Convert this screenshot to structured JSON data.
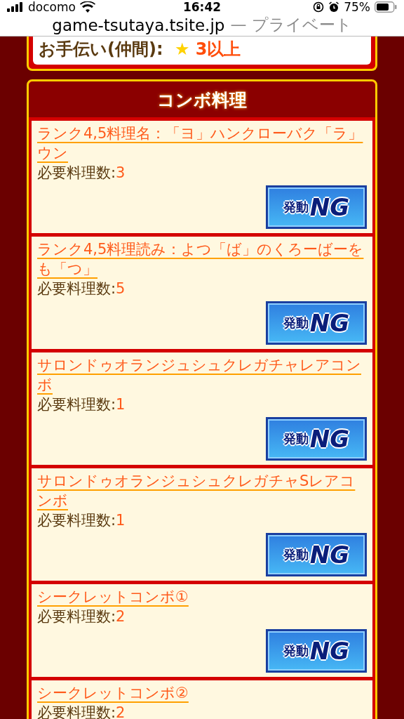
{
  "status_bar": {
    "carrier": "docomo",
    "time": "16:42",
    "battery": "75%"
  },
  "address_bar": {
    "domain": "game-tsutaya.tsite.jp",
    "suffix": "— プライベート"
  },
  "helper": {
    "label": "お手伝い(仲間):",
    "star": "★",
    "value": "3以上"
  },
  "combo": {
    "title": "コンボ料理",
    "items": [
      {
        "name": "ランク4,5料理名：「ヨ」ハンクローバク「ラ」ウン",
        "count_label": "必要料理数:",
        "count": "3",
        "badge": "発動NG"
      },
      {
        "name": "ランク4,5料理読み：よつ「ば」のくろーばーをも「つ」",
        "count_label": "必要料理数:",
        "count": "5",
        "badge": "発動NG"
      },
      {
        "name": "サロンドゥオランジュシュクレガチャレアコンボ",
        "count_label": "必要料理数:",
        "count": "1",
        "badge": "発動NG"
      },
      {
        "name": "サロンドゥオランジュシュクレガチャSレアコンボ",
        "count_label": "必要料理数:",
        "count": "1",
        "badge": "発動NG"
      },
      {
        "name": "シークレットコンボ①",
        "count_label": "必要料理数:",
        "count": "2",
        "badge": "発動NG"
      },
      {
        "name": "シークレットコンボ②",
        "count_label": "必要料理数:",
        "count": "2"
      }
    ]
  }
}
